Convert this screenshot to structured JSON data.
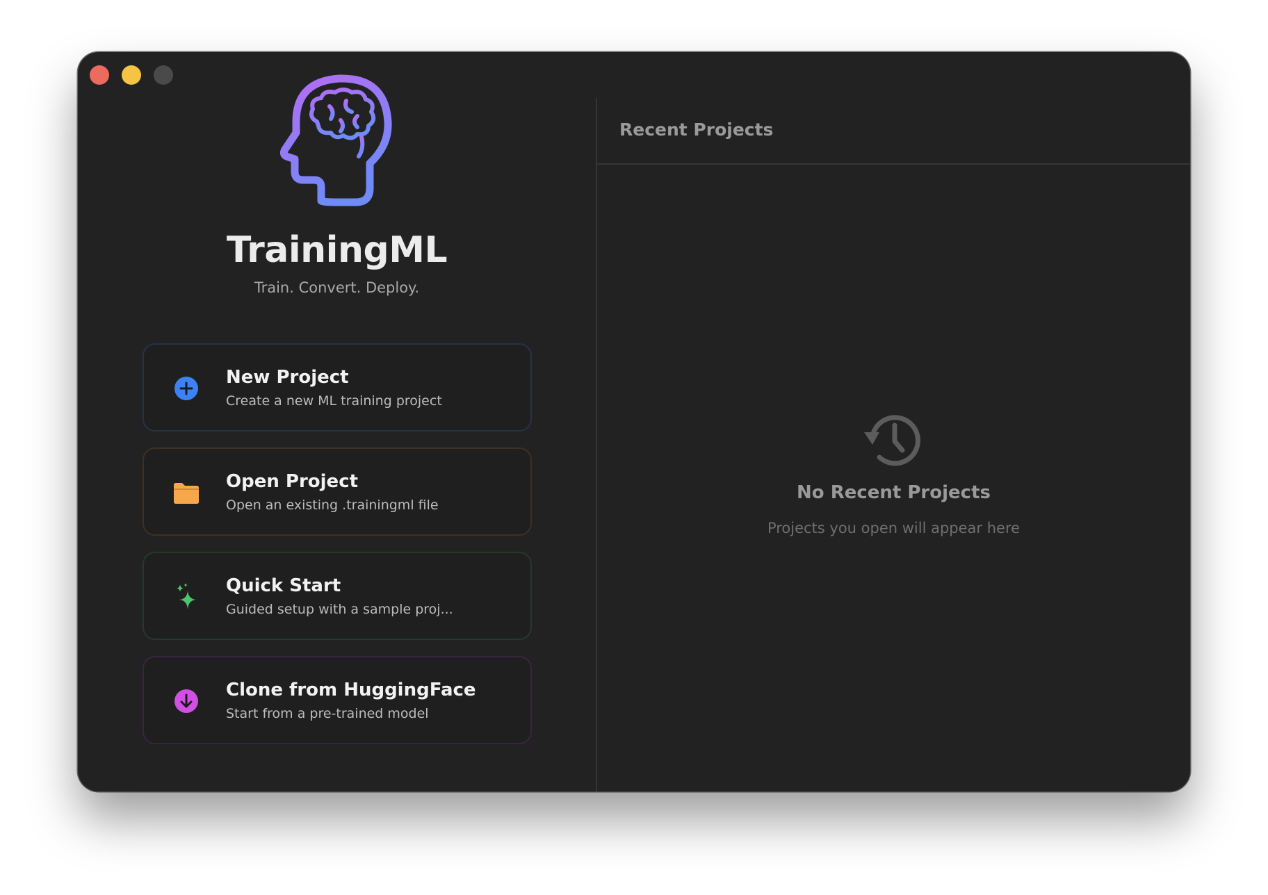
{
  "window": {
    "controls": [
      "close",
      "minimize",
      "zoom"
    ]
  },
  "app": {
    "name": "TrainingML",
    "tagline": "Train. Convert. Deploy.",
    "logo_icon": "brain-head-icon",
    "logo_gradient": [
      "#b56cf5",
      "#6f8bf7"
    ]
  },
  "actions": [
    {
      "title": "New Project",
      "subtitle": "Create a new ML training project",
      "icon": "plus-circle-icon",
      "color": "#3b82f6"
    },
    {
      "title": "Open Project",
      "subtitle": "Open an existing .trainingml file",
      "icon": "folder-icon",
      "color": "#f5a74a"
    },
    {
      "title": "Quick Start",
      "subtitle": "Guided setup with a sample proj...",
      "icon": "sparkles-icon",
      "color": "#4cc46a"
    },
    {
      "title": "Clone from HuggingFace",
      "subtitle": "Start from a pre-trained model",
      "icon": "download-circle-icon",
      "color": "#d24fe6"
    }
  ],
  "recent": {
    "header": "Recent Projects",
    "empty_icon": "history-icon",
    "empty_title": "No Recent Projects",
    "empty_subtitle": "Projects you open will appear here"
  }
}
